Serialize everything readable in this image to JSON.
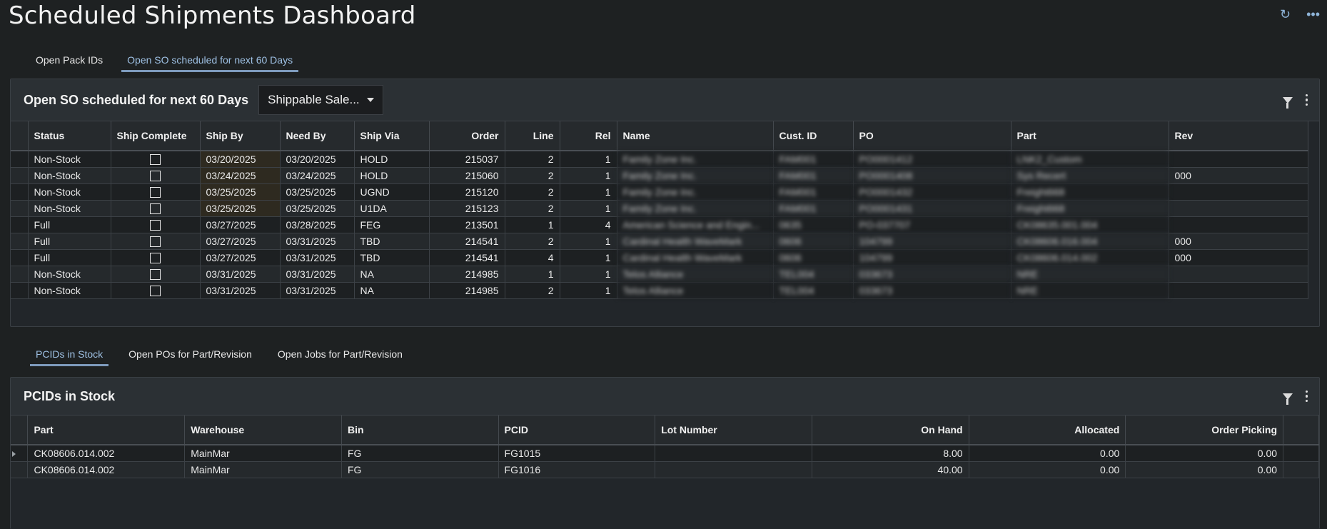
{
  "app": {
    "title": "Scheduled Shipments Dashboard"
  },
  "top_icons": [
    "refresh-icon",
    "more-icon"
  ],
  "top_tabs": [
    {
      "label": "Open Pack IDs",
      "active": false
    },
    {
      "label": "Open SO scheduled for next 60 Days",
      "active": true
    }
  ],
  "so_panel": {
    "title": "Open SO scheduled for next 60 Days",
    "dropdown_value": "Shippable Sale...",
    "columns": [
      "Status",
      "Ship Complete",
      "Ship By",
      "Need By",
      "Ship Via",
      "Order",
      "Line",
      "Rel",
      "Name",
      "Cust. ID",
      "PO",
      "Part",
      "Rev"
    ],
    "rows": [
      {
        "status": "Non-Stock",
        "ship_by": "03/20/2025",
        "need_by": "03/20/2025",
        "ship_via": "HOLD",
        "order": "215037",
        "line": "2",
        "rel": "1",
        "name": "Family Zone Inc.",
        "cust": "FAM001",
        "po": "PO0001412",
        "part": "LNK2_Custom",
        "rev": ""
      },
      {
        "status": "Non-Stock",
        "ship_by": "03/24/2025",
        "need_by": "03/24/2025",
        "ship_via": "HOLD",
        "order": "215060",
        "line": "2",
        "rel": "1",
        "name": "Family Zone Inc.",
        "cust": "FAM001",
        "po": "PO0001408",
        "part": "Sys Recert",
        "rev": "000"
      },
      {
        "status": "Non-Stock",
        "ship_by": "03/25/2025",
        "need_by": "03/25/2025",
        "ship_via": "UGND",
        "order": "215120",
        "line": "2",
        "rel": "1",
        "name": "Family Zone Inc.",
        "cust": "FAM001",
        "po": "PO0001432",
        "part": "Freight668",
        "rev": ""
      },
      {
        "status": "Non-Stock",
        "ship_by": "03/25/2025",
        "need_by": "03/25/2025",
        "ship_via": "U1DA",
        "order": "215123",
        "line": "2",
        "rel": "1",
        "name": "Family Zone Inc.",
        "cust": "FAM001",
        "po": "PO0001431",
        "part": "Freight668",
        "rev": ""
      },
      {
        "status": "Full",
        "ship_by": "03/27/2025",
        "need_by": "03/28/2025",
        "ship_via": "FEG",
        "order": "213501",
        "line": "1",
        "rel": "4",
        "name": "American Science and Engin...",
        "cust": "0635",
        "po": "PO-037707",
        "part": "CK08635.001.004",
        "rev": ""
      },
      {
        "status": "Full",
        "ship_by": "03/27/2025",
        "need_by": "03/31/2025",
        "ship_via": "TBD",
        "order": "214541",
        "line": "2",
        "rel": "1",
        "name": "Cardinal Health WaveMark",
        "cust": "0606",
        "po": "104799",
        "part": "CK08606.016.004",
        "rev": "000"
      },
      {
        "status": "Full",
        "ship_by": "03/27/2025",
        "need_by": "03/31/2025",
        "ship_via": "TBD",
        "order": "214541",
        "line": "4",
        "rel": "1",
        "name": "Cardinal Health WaveMark",
        "cust": "0606",
        "po": "104799",
        "part": "CK08606.014.002",
        "rev": "000"
      },
      {
        "status": "Non-Stock",
        "ship_by": "03/31/2025",
        "need_by": "03/31/2025",
        "ship_via": "NA",
        "order": "214985",
        "line": "1",
        "rel": "1",
        "name": "Telos Alliance",
        "cust": "TEL004",
        "po": "033673",
        "part": "NRE",
        "rev": ""
      },
      {
        "status": "Non-Stock",
        "ship_by": "03/31/2025",
        "need_by": "03/31/2025",
        "ship_via": "NA",
        "order": "214985",
        "line": "2",
        "rel": "1",
        "name": "Telos Alliance",
        "cust": "TEL004",
        "po": "033673",
        "part": "NRE",
        "rev": ""
      }
    ]
  },
  "bottom_tabs": [
    {
      "label": "PCIDs in Stock",
      "active": true
    },
    {
      "label": "Open POs for Part/Revision",
      "active": false
    },
    {
      "label": "Open Jobs for Part/Revision",
      "active": false
    }
  ],
  "pcid_panel": {
    "title": "PCIDs in Stock",
    "columns": [
      "Part",
      "Warehouse",
      "Bin",
      "PCID",
      "Lot Number",
      "On Hand",
      "Allocated",
      "Order Picking"
    ],
    "rows": [
      {
        "part": "CK08606.014.002",
        "warehouse": "MainMar",
        "bin": "FG",
        "pcid": "FG1015",
        "lot": "",
        "on_hand": "8.00",
        "allocated": "0.00",
        "order_picking": "0.00"
      },
      {
        "part": "CK08606.014.002",
        "warehouse": "MainMar",
        "bin": "FG",
        "pcid": "FG1016",
        "lot": "",
        "on_hand": "40.00",
        "allocated": "0.00",
        "order_picking": "0.00"
      }
    ]
  }
}
